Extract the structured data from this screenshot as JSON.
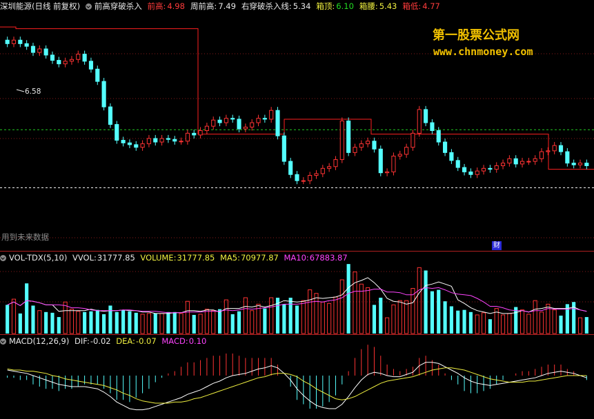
{
  "header": {
    "stock": "深圳能源(日线 前复权)",
    "indicator": "前高穿破杀入",
    "items": [
      {
        "label": "前高:",
        "value": "4.98",
        "labelColor": "#ff3b3b",
        "valueColor": "#ff3b3b"
      },
      {
        "label": "周前高:",
        "value": "7.49",
        "labelColor": "#e8e8e8",
        "valueColor": "#e8e8e8"
      },
      {
        "label": "右穿破杀入线:",
        "value": "5.34",
        "labelColor": "#e8e8e8",
        "valueColor": "#e8e8e8"
      },
      {
        "label": "箱顶:",
        "value": "6.10",
        "labelColor": "#f0f040",
        "valueColor": "#22dd22"
      },
      {
        "label": "箱腰:",
        "value": "5.43",
        "labelColor": "#f0f040",
        "valueColor": "#f0f040"
      },
      {
        "label": "箱低:",
        "value": "4.77",
        "labelColor": "#ff3b3b",
        "valueColor": "#ff3b3b"
      }
    ]
  },
  "watermark": {
    "line1": "第一股票公式网",
    "line2": "www.chnmoney.com"
  },
  "price_label": "6.58",
  "future_note": "用到未来数据",
  "finance_badge": "财",
  "volume_header": {
    "name": "VOL-TDX(5,10)",
    "vvol_label": "VVOL:",
    "vvol": "31777.85",
    "volume_label": "VOLUME:",
    "volume": "31777.85",
    "ma5_label": "MA5:",
    "ma5": "70977.87",
    "ma10_label": "MA10:",
    "ma10": "67883.87"
  },
  "macd_header": {
    "name": "MACD(12,26,9)",
    "dif_label": "DIF:",
    "dif": "-0.02",
    "dea_label": "DEA:",
    "dea": "-0.07",
    "macd_label": "MACD:",
    "macd": "0.10"
  },
  "colors": {
    "up": "#ff3333",
    "down": "#54ffff",
    "ma5": "#ffffff",
    "ma10": "#ff44ff",
    "dif": "#ffffff",
    "dea": "#f0f040",
    "resistance": "#ff2020",
    "box": "#22cc22",
    "low": "#ffffff"
  },
  "chart_data": {
    "type": "candlestick",
    "title": "深圳能源(日线 前复权)",
    "resistance_levels": [
      6.6,
      6.58,
      5.38,
      5.55,
      5.38,
      4.98
    ],
    "box": {
      "top": 6.1,
      "mid": 5.43,
      "low": 4.77
    },
    "prices": {
      "opens": [
        6.45,
        6.41,
        6.45,
        6.41,
        6.38,
        6.31,
        6.35,
        6.28,
        6.22,
        6.18,
        6.21,
        6.23,
        6.29,
        6.21,
        6.12,
        5.98,
        5.69,
        5.49,
        5.31,
        5.28,
        5.26,
        5.23,
        5.27,
        5.33,
        5.29,
        5.33,
        5.32,
        5.3,
        5.3,
        5.39,
        5.37,
        5.42,
        5.47,
        5.54,
        5.51,
        5.56,
        5.55,
        5.44,
        5.46,
        5.51,
        5.56,
        5.55,
        5.65,
        5.36,
        5.07,
        4.92,
        4.85,
        4.85,
        4.91,
        4.93,
        4.99,
        5.01,
        5.09,
        5.53,
        5.17,
        5.23,
        5.27,
        5.3,
        5.21,
        4.94,
        4.95,
        5.13,
        5.15,
        5.23,
        5.39,
        5.66,
        5.51,
        5.42,
        5.29,
        5.17,
        5.08,
        5.0,
        4.95,
        4.92,
        4.96,
        4.99,
        4.98,
        5.02,
        5.05,
        5.1,
        5.04,
        5.07,
        5.07,
        5.1,
        5.18,
        5.19,
        5.25,
        5.18,
        5.05,
        5.03,
        5.05
      ],
      "closes": [
        6.41,
        6.45,
        6.41,
        6.38,
        6.31,
        6.35,
        6.28,
        6.22,
        6.18,
        6.21,
        6.23,
        6.29,
        6.21,
        6.12,
        5.98,
        5.69,
        5.49,
        5.31,
        5.28,
        5.26,
        5.23,
        5.27,
        5.33,
        5.29,
        5.33,
        5.32,
        5.3,
        5.3,
        5.39,
        5.37,
        5.42,
        5.47,
        5.54,
        5.51,
        5.56,
        5.55,
        5.44,
        5.46,
        5.51,
        5.56,
        5.55,
        5.65,
        5.36,
        5.07,
        4.92,
        4.85,
        4.85,
        4.91,
        4.93,
        4.99,
        5.01,
        5.09,
        5.53,
        5.17,
        5.23,
        5.27,
        5.3,
        5.21,
        4.94,
        4.95,
        5.13,
        5.15,
        5.23,
        5.39,
        5.66,
        5.51,
        5.42,
        5.29,
        5.17,
        5.08,
        5.0,
        4.95,
        4.92,
        4.96,
        4.99,
        4.98,
        5.02,
        5.05,
        5.1,
        5.04,
        5.07,
        5.07,
        5.1,
        5.18,
        5.19,
        5.25,
        5.18,
        5.05,
        5.03,
        5.05,
        5.02
      ]
    },
    "volume": [
      40,
      48,
      28,
      70,
      39,
      32,
      30,
      29,
      23,
      44,
      34,
      31,
      30,
      31,
      33,
      27,
      39,
      30,
      33,
      31,
      29,
      27,
      28,
      28,
      28,
      30,
      30,
      28,
      45,
      26,
      27,
      34,
      32,
      34,
      47,
      27,
      31,
      50,
      32,
      41,
      35,
      50,
      50,
      41,
      50,
      39,
      46,
      61,
      56,
      44,
      42,
      51,
      75,
      97,
      86,
      69,
      64,
      40,
      50,
      22,
      40,
      46,
      46,
      63,
      92,
      88,
      59,
      61,
      45,
      38,
      32,
      33,
      30,
      26,
      29,
      20,
      35,
      26,
      28,
      37,
      33,
      27,
      46,
      30,
      41,
      33,
      25,
      41,
      44,
      22,
      23
    ],
    "volume_ma5": [
      40,
      44,
      39,
      46,
      45,
      43,
      40,
      40,
      31,
      32,
      32,
      32,
      32,
      34,
      32,
      31,
      32,
      32,
      33,
      32,
      32,
      30,
      30,
      28,
      28,
      28,
      29,
      29,
      32,
      32,
      31,
      33,
      33,
      30,
      35,
      35,
      35,
      38,
      37,
      39,
      37,
      39,
      42,
      46,
      45,
      44,
      45,
      47,
      50,
      49,
      50,
      51,
      54,
      64,
      71,
      74,
      78,
      71,
      62,
      49,
      45,
      44,
      41,
      43,
      57,
      67,
      69,
      72,
      69,
      66,
      47,
      42,
      36,
      32,
      30,
      28,
      30,
      28,
      28,
      29,
      32,
      30,
      34,
      35,
      37,
      35,
      35,
      35,
      37,
      33,
      31
    ],
    "volume_ma10": [
      40,
      44,
      39,
      46,
      45,
      43,
      40,
      40,
      40,
      39,
      36,
      36,
      35,
      33,
      32,
      32,
      32,
      32,
      33,
      33,
      32,
      31,
      31,
      31,
      30,
      29,
      29,
      29,
      30,
      30,
      30,
      31,
      31,
      31,
      33,
      32,
      33,
      35,
      34,
      35,
      36,
      37,
      39,
      41,
      41,
      41,
      42,
      44,
      45,
      44,
      46,
      47,
      50,
      56,
      59,
      59,
      60,
      62,
      62,
      58,
      58,
      57,
      54,
      54,
      61,
      64,
      63,
      64,
      61,
      57,
      55,
      54,
      53,
      49,
      44,
      38,
      38,
      36,
      33,
      32,
      32,
      30,
      32,
      32,
      35,
      34,
      34,
      34,
      35,
      33,
      31
    ],
    "macd_dif": [
      0.05,
      0.04,
      0.03,
      0.02,
      0.0,
      -0.02,
      -0.04,
      -0.06,
      -0.08,
      -0.09,
      -0.1,
      -0.1,
      -0.1,
      -0.11,
      -0.12,
      -0.15,
      -0.19,
      -0.24,
      -0.27,
      -0.3,
      -0.31,
      -0.31,
      -0.3,
      -0.28,
      -0.26,
      -0.24,
      -0.22,
      -0.2,
      -0.17,
      -0.15,
      -0.13,
      -0.1,
      -0.07,
      -0.05,
      -0.02,
      0.0,
      0.01,
      0.02,
      0.04,
      0.06,
      0.07,
      0.09,
      0.07,
      0.02,
      -0.04,
      -0.12,
      -0.18,
      -0.23,
      -0.27,
      -0.29,
      -0.3,
      -0.3,
      -0.26,
      -0.19,
      -0.11,
      -0.04,
      0.01,
      0.03,
      0.02,
      0.0,
      -0.01,
      -0.01,
      0.01,
      0.03,
      0.09,
      0.12,
      0.12,
      0.11,
      0.08,
      0.05,
      0.02,
      -0.02,
      -0.05,
      -0.07,
      -0.08,
      -0.09,
      -0.08,
      -0.07,
      -0.06,
      -0.05,
      -0.04,
      -0.03,
      -0.02,
      0.0,
      0.02,
      0.03,
      0.04,
      0.03,
      0.02,
      0.0,
      -0.02
    ],
    "macd_dea": [
      0.06,
      0.05,
      0.05,
      0.04,
      0.04,
      0.03,
      0.02,
      0.0,
      -0.01,
      -0.03,
      -0.04,
      -0.05,
      -0.06,
      -0.07,
      -0.08,
      -0.09,
      -0.11,
      -0.13,
      -0.16,
      -0.18,
      -0.21,
      -0.23,
      -0.24,
      -0.25,
      -0.25,
      -0.25,
      -0.24,
      -0.24,
      -0.23,
      -0.21,
      -0.2,
      -0.18,
      -0.16,
      -0.14,
      -0.12,
      -0.1,
      -0.08,
      -0.06,
      -0.04,
      -0.02,
      -0.01,
      0.01,
      0.02,
      0.02,
      0.01,
      -0.01,
      -0.05,
      -0.08,
      -0.12,
      -0.15,
      -0.18,
      -0.21,
      -0.22,
      -0.21,
      -0.19,
      -0.16,
      -0.13,
      -0.1,
      -0.07,
      -0.05,
      -0.04,
      -0.03,
      -0.02,
      -0.01,
      0.01,
      0.03,
      0.05,
      0.06,
      0.07,
      0.07,
      0.06,
      0.05,
      0.03,
      0.01,
      -0.01,
      -0.03,
      -0.04,
      -0.05,
      -0.06,
      -0.06,
      -0.06,
      -0.05,
      -0.05,
      -0.04,
      -0.03,
      -0.02,
      -0.01,
      0.0,
      0.0,
      0.0,
      0.0
    ]
  }
}
